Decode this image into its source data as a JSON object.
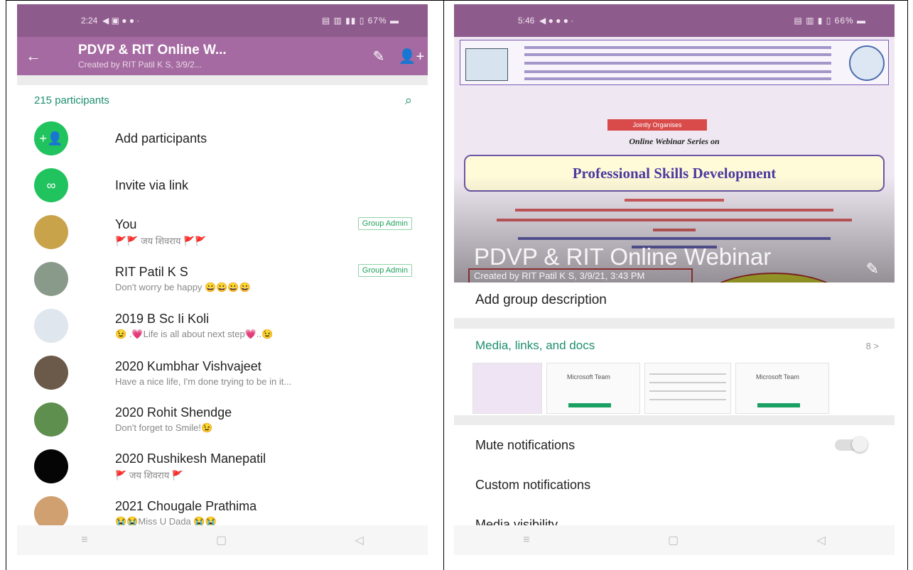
{
  "left": {
    "status": {
      "time": "2:24",
      "icons": "◀ ▣ ● ● ·",
      "right": "▤ ▥ ▮▮ ▯ 67% ▬"
    },
    "header": {
      "title": "PDVP & RIT Online W...",
      "subtitle": "Created by RIT Patil K S, 3/9/2..."
    },
    "participants_label": "215 participants",
    "actions": [
      {
        "label": "Add participants",
        "icon": "person-add-icon"
      },
      {
        "label": "Invite via link",
        "icon": "link-icon"
      }
    ],
    "members": [
      {
        "name": "You",
        "about": "🚩🚩 जय शिवराय 🚩🚩",
        "admin": "Group Admin",
        "avatar": "#c9a34a"
      },
      {
        "name": "RIT Patil K S",
        "about": "Don't worry be happy 😀😀😀😀",
        "admin": "Group Admin",
        "avatar": "#8a9a8a"
      },
      {
        "name": "2019 B Sc Ii Koli",
        "about": "😉 .💗Life is all about next step💗..😉",
        "admin": "",
        "avatar": "#dfe6ee"
      },
      {
        "name": "2020 Kumbhar Vishvajeet",
        "about": "Have a nice life, I'm done trying to be in it...",
        "admin": "",
        "avatar": "#6b5a4a"
      },
      {
        "name": "2020 Rohit Shendge",
        "about": "Don't forget to Smile!😉",
        "admin": "",
        "avatar": "#5e8f4f"
      },
      {
        "name": "2020 Rushikesh Manepatil",
        "about": "🚩 जय शिवराय 🚩",
        "admin": "",
        "avatar": "#050505"
      },
      {
        "name": "2021 Chougale Prathima",
        "about": "😭😭Miss U Dada 😭😭",
        "admin": "",
        "avatar": "#d0a070"
      }
    ],
    "nav": {
      "menu": "≡",
      "home": "▢",
      "back": "◁"
    }
  },
  "right": {
    "status": {
      "time": "5:46",
      "icons": "◀ ● ● ● ·",
      "right": "▤ ▥ ▮ ▯ 66% ▬"
    },
    "banner": {
      "organise": "Jointly Organises",
      "series": "Online Webinar Series on",
      "headline": "Professional Skills Development",
      "group_title": "PDVP & RIT Online Webinar",
      "group_sub": "Created by RIT Patil K S, 3/9/21, 3:43 PM"
    },
    "description_prompt": "Add group description",
    "media": {
      "title": "Media, links, and docs",
      "count": "8 >",
      "doc_label": "Microsoft Team"
    },
    "settings": [
      "Mute notifications",
      "Custom notifications",
      "Media visibility"
    ],
    "nav": {
      "menu": "≡",
      "home": "▢",
      "back": "◁"
    },
    "colors": {
      "header": "#a56aa1",
      "status": "#8e5c8c",
      "accent": "#1f8f6e",
      "fab": "#21c35e"
    }
  }
}
